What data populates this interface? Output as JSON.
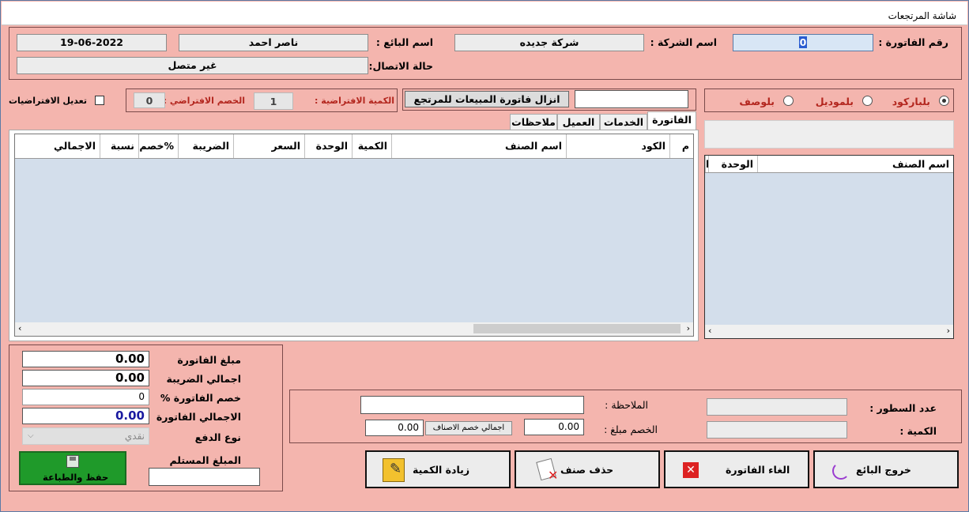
{
  "window": {
    "title": "شاشة المرتجعات"
  },
  "header": {
    "invoice_number_label": "رقم الفاتورة :",
    "invoice_number_value": "0",
    "company_label": "اسم الشركة :",
    "company_value": "شركة جديده",
    "seller_label": "اسم البائع :",
    "seller_value": "ناصر احمد",
    "date_value": "19-06-2022",
    "connection_label": "حالة الاتصال:",
    "connection_value": "غير متصل"
  },
  "search": {
    "radio_barcode": "بلباركود",
    "radio_model": "بلموديل",
    "radio_desc": "بلوصف",
    "selected": "barcode",
    "results_columns": [
      "اسم الصنف",
      "الوحدة",
      "ا"
    ]
  },
  "toolbar": {
    "load_button": "انزال فاتورة المبيعات للمرتجع",
    "default_qty_label": "الكمية الافتراضية :",
    "default_qty_value": "1",
    "default_discount_label": "الخصم الافتراضي :",
    "default_discount_value": "0",
    "edit_defaults_label": "تعديل الافتراضيات"
  },
  "tabs": [
    "الفاتورة",
    "الخدمات",
    "العميل",
    "ملاحظات"
  ],
  "invoice_grid": {
    "columns": [
      "م",
      "الكود",
      "اسم الصنف",
      "الكمية",
      "الوحدة",
      "السعر",
      "الضريبة",
      "خصم%",
      "نسبة",
      "الاجمالي"
    ]
  },
  "totals": {
    "invoice_amount_label": "مبلغ الفاتورة",
    "invoice_amount_value": "0.00",
    "tax_total_label": "اجمالي الضريبة",
    "tax_total_value": "0.00",
    "invoice_discount_label": "خصم الفاتورة %",
    "invoice_discount_value": "0",
    "invoice_total_label": "الاجمالي الفاتورة",
    "invoice_total_value": "0.00",
    "payment_type_label": "نوع الدفع",
    "payment_type_value": "نقدي",
    "received_label": "المبلغ المستلم",
    "save_print_button": "حفظ والطباعة"
  },
  "summary": {
    "lines_count_label": "عدد السطور :",
    "quantity_label": "الكمية :",
    "note_label": "الملاحظة :",
    "discount_amount_label": "الخصم مبلغ :",
    "discount_amount_value": "0.00",
    "items_discount_label": "اجمالي خصم الاصناف",
    "items_discount_value": "0.00"
  },
  "actions": {
    "exit_seller": "خروج البائع",
    "cancel_invoice": "الغاء الفاتورة",
    "delete_item": "حذف صنف",
    "increase_qty": "زيادة الكمية"
  },
  "colors": {
    "background": "#f4b5ae",
    "grid": "#d3deeb",
    "accent": "#1a1aa0",
    "save_green": "#1f9a2a"
  }
}
